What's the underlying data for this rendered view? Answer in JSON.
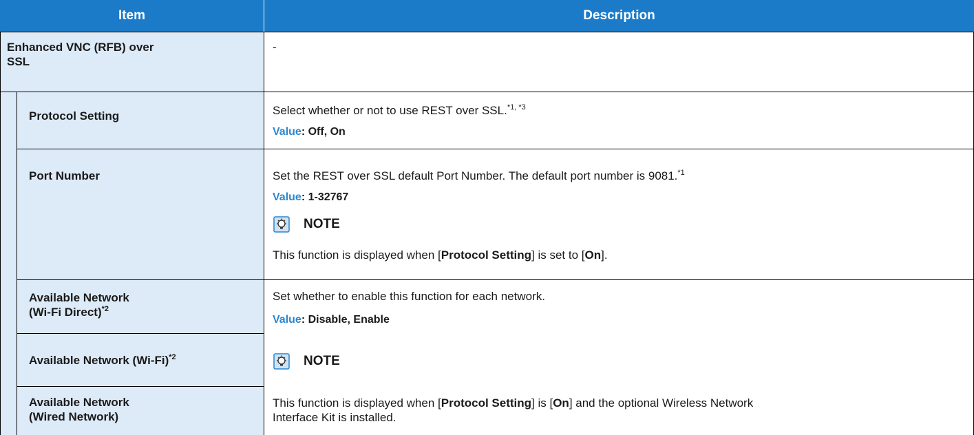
{
  "header": {
    "item": "Item",
    "description": "Description"
  },
  "group": {
    "item": "Enhanced VNC (RFB) over SSL",
    "item_line1": "Enhanced VNC (RFB) over",
    "item_line2": "SSL",
    "description": "-"
  },
  "rows": {
    "protocol": {
      "item": "Protocol Setting",
      "desc": "Select whether or not to use REST over SSL.",
      "desc_sup": "*1, *3",
      "value_label": "Value",
      "value_text": ": Off, On"
    },
    "port": {
      "item": "Port Number",
      "desc": "Set the REST over SSL default Port Number. The default port number is 9081.",
      "desc_sup": "*1",
      "value_label": "Value",
      "value_text": ": 1-32767",
      "note_label": "NOTE",
      "note_pre": "This function is displayed when [",
      "note_b1": "Protocol Setting",
      "note_mid": "] is set to [",
      "note_b2": "On",
      "note_post": "]."
    },
    "wifi_direct": {
      "item_line1": "Available Network",
      "item_line2": "(Wi-Fi Direct)",
      "sup": "*2"
    },
    "wifi": {
      "item": "Available Network (Wi-Fi)",
      "sup": "*2"
    },
    "wired": {
      "item_line1": "Available Network",
      "item_line2": "(Wired Network)"
    },
    "network_desc": {
      "desc": "Set whether to enable this function for each network.",
      "value_label": "Value",
      "value_text": ": Disable, Enable",
      "note_label": "NOTE",
      "note_pre": "This function is displayed when [",
      "note_b1": "Protocol Setting",
      "note_mid": "] is [",
      "note_b2": "On",
      "note_post": "] and the optional Wireless Network",
      "note_line2": "Interface Kit is installed."
    }
  },
  "colors": {
    "header_bg": "#1b7bc8",
    "item_bg": "#ddeaf7",
    "value_label": "#2a86cf",
    "border": "#000000"
  },
  "icons": {
    "note": "note-lightbulb-icon"
  }
}
